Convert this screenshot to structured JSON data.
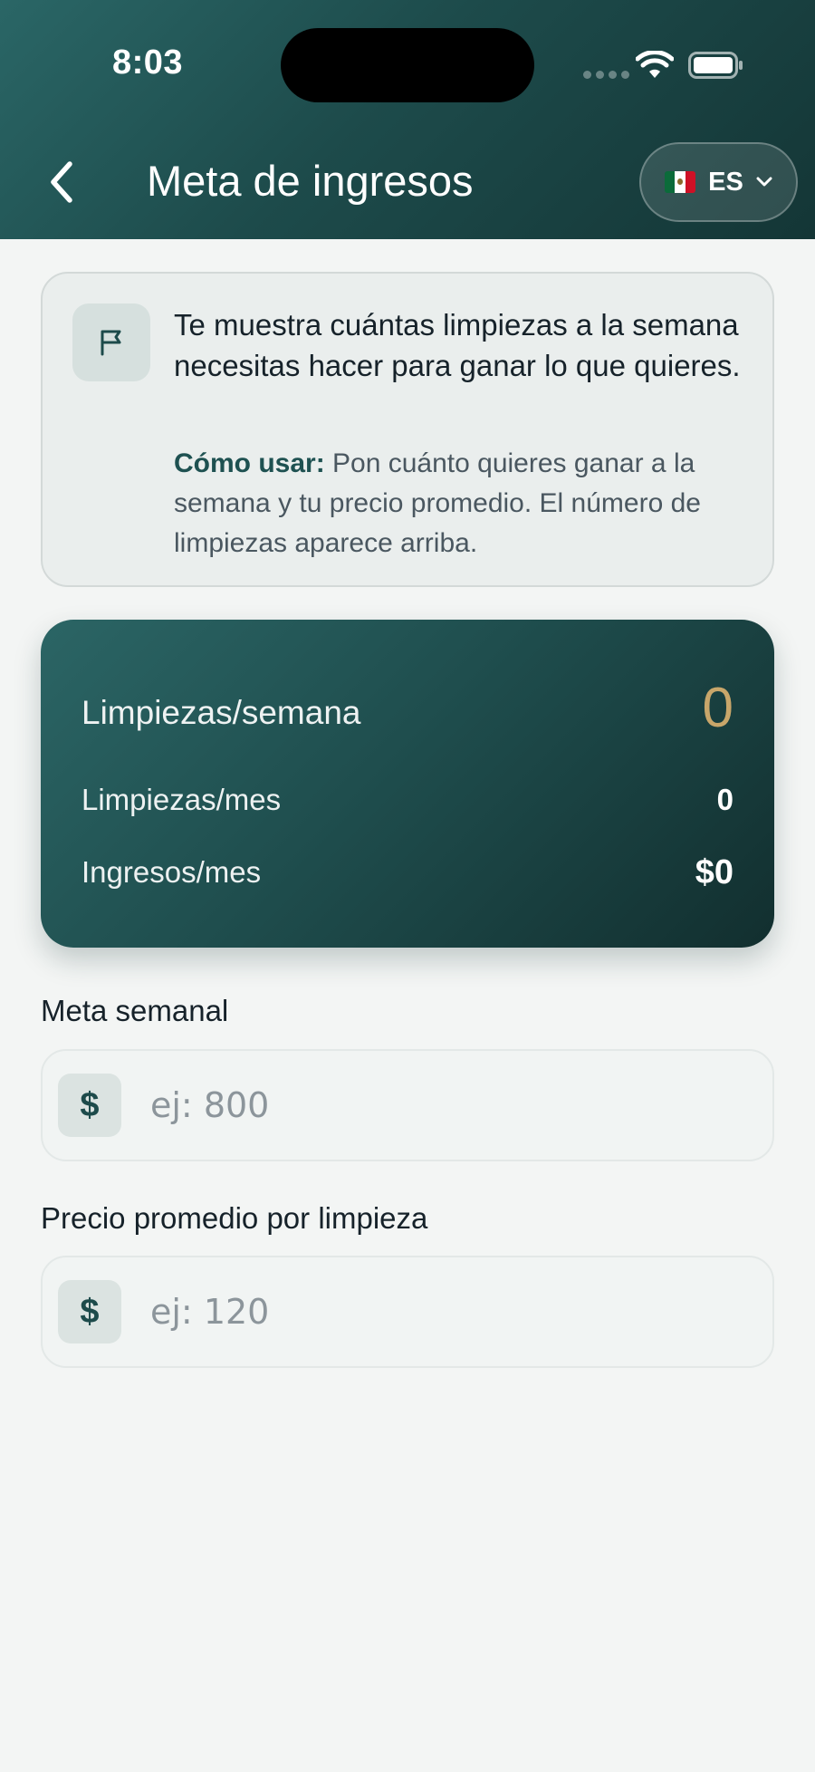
{
  "status_bar": {
    "time": "8:03"
  },
  "header": {
    "title": "Meta de ingresos",
    "language": "ES"
  },
  "info_card": {
    "icon": "flag-icon",
    "title": "Te muestra cuántas limpiezas a la semana necesitas hacer para ganar lo que quieres.",
    "how_label": "Cómo usar:",
    "how_text": " Pon cuánto quieres ganar a la semana y tu precio promedio. El número de limpiezas aparece arriba."
  },
  "summary": {
    "weekly_label": "Limpiezas/semana",
    "weekly_value": "0",
    "monthly_label": "Limpiezas/mes",
    "monthly_value": "0",
    "income_label": "Ingresos/mes",
    "income_value": "$0"
  },
  "weekly_goal": {
    "label": "Meta semanal",
    "currency": "$",
    "placeholder": "ej: 800"
  },
  "avg_price": {
    "label": "Precio promedio por limpieza",
    "currency": "$",
    "placeholder": "ej: 120"
  },
  "colors": {
    "header_start": "#2a6666",
    "header_end": "#143636",
    "accent_gold": "#c8a66a",
    "accent_teal": "#1e5151"
  }
}
